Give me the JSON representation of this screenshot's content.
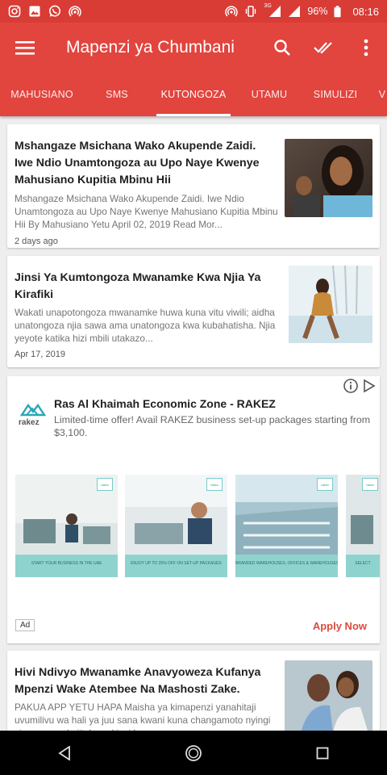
{
  "status_bar": {
    "battery": "96%",
    "time": "08:16",
    "network": "3G",
    "left_icons": [
      "instagram-icon",
      "gallery-icon",
      "whatsapp-icon",
      "hotspot-icon"
    ],
    "right_icons": [
      "hotspot-icon",
      "vibrate-icon",
      "signal-icon",
      "battery-icon"
    ]
  },
  "app_bar": {
    "title": "Mapenzi ya Chumbani",
    "actions": [
      "search-icon",
      "mark-read-icon",
      "more-vert-icon"
    ]
  },
  "tabs": [
    {
      "label": "MAHUSIANO",
      "active": false
    },
    {
      "label": "SMS",
      "active": false
    },
    {
      "label": "KUTONGOZA",
      "active": true
    },
    {
      "label": "UTAMU",
      "active": false
    },
    {
      "label": "SIMULIZI",
      "active": false
    },
    {
      "label": "V",
      "active": false
    }
  ],
  "articles": [
    {
      "headline": "Mshangaze Msichana Wako Akupende Zaidi. Iwe Ndio Unamtongoza au Upo Naye Kwenye Mahusiano Kupitia Mbinu Hii",
      "excerpt": "Mshangaze Msichana Wako Akupende Zaidi. Iwe Ndio Unamtongoza au Upo Naye Kwenye Mahusiano Kupitia Mbinu Hii By Mahusiano Yetu April 02, 2019 Read Mor...",
      "date": "2 days ago"
    },
    {
      "headline": "Jinsi Ya Kumtongoza Mwanamke Kwa Njia Ya Kirafiki",
      "excerpt": "Wakati unapotongoza mwanamke huwa kuna vitu viwili; aidha unatongoza njia sawa ama unatongoza kwa kubahatisha. Njia yeyote katika hizi mbili utakazo...",
      "date": "Apr 17, 2019"
    },
    {
      "headline": "Hivi Ndivyo Mwanamke Anavyoweza Kufanya Mpenzi Wake Atembee Na Mashosti Zake.",
      "excerpt": "PAKUA APP YETU HAPA Maisha ya kimapenzi yanahitaji uvumilivu wa hali ya juu sana kwani kuna changamoto nyingi zinazoweza kujitokeza kiasi kwam...",
      "date": ""
    }
  ],
  "ad": {
    "logo_text": "rakez",
    "title": "Ras Al Khaimah Economic Zone - RAKEZ",
    "description": "Limited-time offer! Avail RAKEZ business set-up packages starting from $3,100.",
    "creatives": [
      {
        "caption": "START YOUR BUSINESS IN THE UAE",
        "badge": "rakez"
      },
      {
        "caption": "ENJOY UP TO 25% OFF ON SET-UP PACKAGES",
        "badge": "rakez"
      },
      {
        "caption": "BRANDED WAREHOUSES, OFFICES & WAREHOUSES",
        "badge": "rakez"
      },
      {
        "caption": "SELECT",
        "badge": "rakez"
      }
    ],
    "badge": "Ad",
    "cta": "Apply Now"
  },
  "colors": {
    "primary": "#e2443e",
    "status_bar": "#d93b35",
    "ad_cta": "#d84c3f"
  }
}
